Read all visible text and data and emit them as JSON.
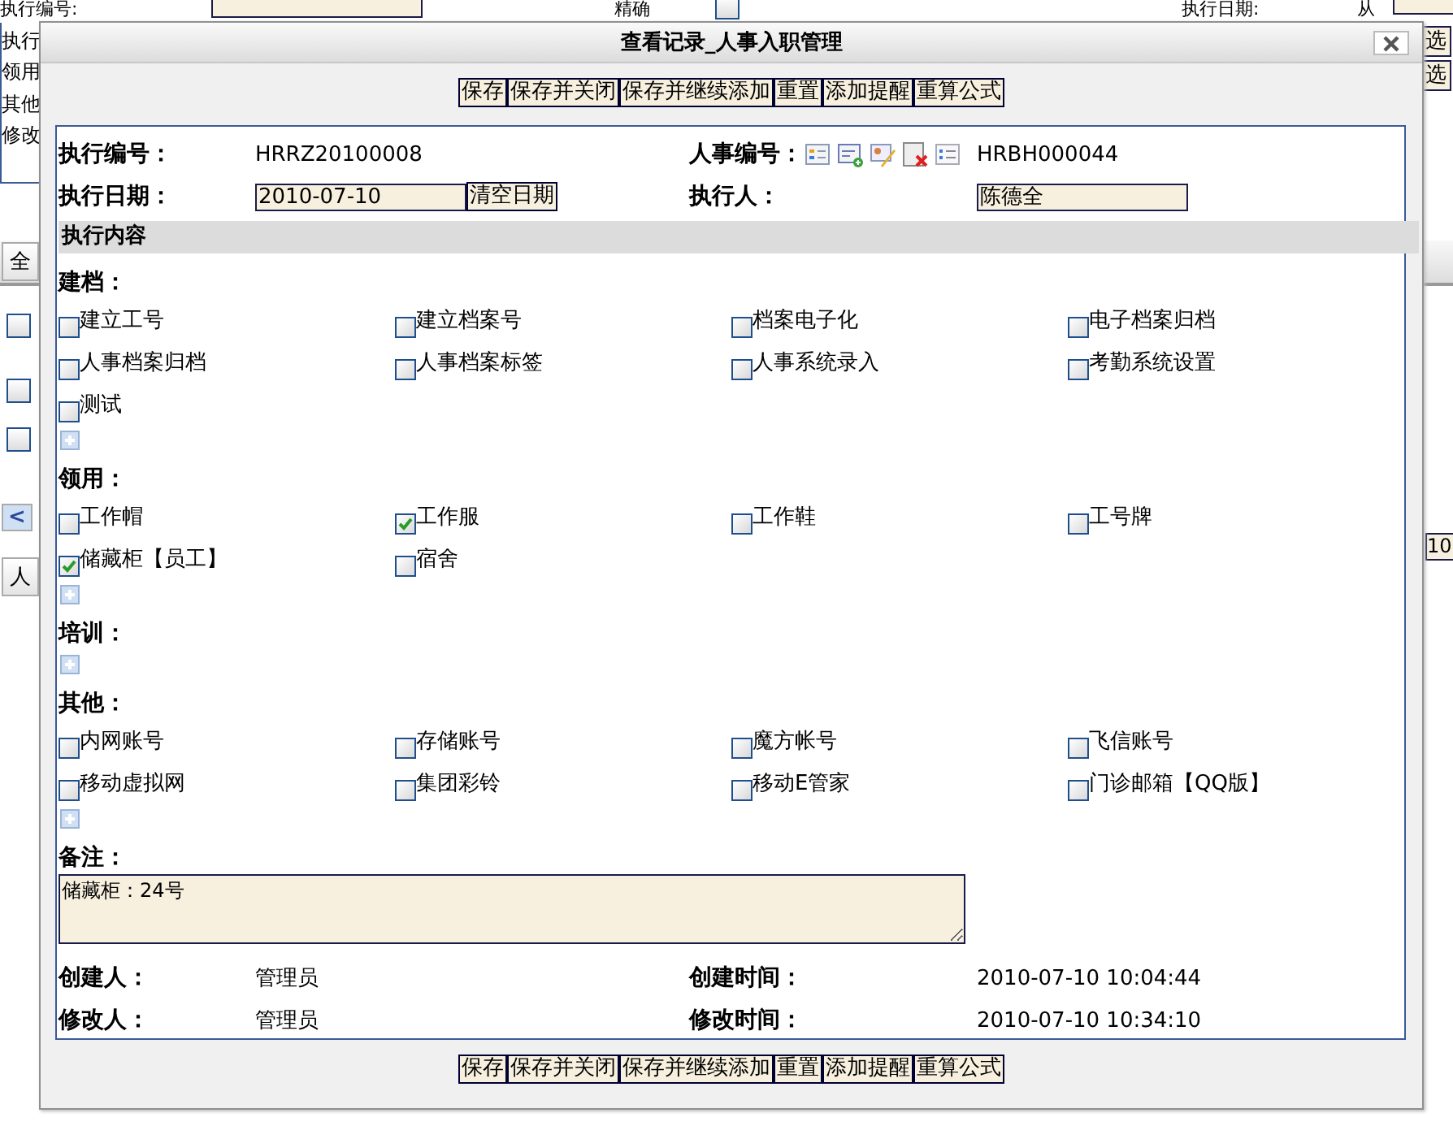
{
  "page_behind": {
    "left_labels": [
      "执行编号:",
      "执行",
      "领用",
      "其他",
      "修改"
    ],
    "match_label": "精确",
    "match_checked": false,
    "date_label": "执行日期:",
    "from_label": "从",
    "choose_buttons": [
      "选",
      "选"
    ],
    "tab": "全",
    "row_checkboxes": [
      {
        "checked": false
      },
      {
        "checked": false
      },
      {
        "checked": false
      }
    ],
    "scroll_left": "<",
    "page_size": "10",
    "bottom_tab": "人"
  },
  "dialog": {
    "title": "查看记录_人事入职管理",
    "toolbar_top": [
      "保存",
      "保存并关闭",
      "保存并继续添加",
      "重置",
      "添加提醒",
      "重算公式"
    ],
    "exec_no": {
      "label": "执行编号：",
      "value": "HRRZ20100008"
    },
    "person_no": {
      "label": "人事编号：",
      "value": "HRBH000044"
    },
    "exec_date": {
      "label": "执行日期：",
      "value": "2010-07-10",
      "clear_button": "清空日期"
    },
    "executor": {
      "label": "执行人：",
      "value": "陈德全"
    },
    "section": "执行内容",
    "groups": [
      {
        "title": "建档：",
        "items": [
          {
            "label": "建立工号",
            "checked": false
          },
          {
            "label": "建立档案号",
            "checked": false
          },
          {
            "label": "档案电子化",
            "checked": false
          },
          {
            "label": "电子档案归档",
            "checked": false
          },
          {
            "label": "人事档案归档",
            "checked": false
          },
          {
            "label": "人事档案标签",
            "checked": false
          },
          {
            "label": "人事系统录入",
            "checked": false
          },
          {
            "label": "考勤系统设置",
            "checked": false
          },
          {
            "label": "测试",
            "checked": false
          }
        ]
      },
      {
        "title": "领用：",
        "items": [
          {
            "label": "工作帽",
            "checked": false
          },
          {
            "label": "工作服",
            "checked": true
          },
          {
            "label": "工作鞋",
            "checked": false
          },
          {
            "label": "工号牌",
            "checked": false
          },
          {
            "label": "储藏柜【员工】",
            "checked": true
          },
          {
            "label": "宿舍",
            "checked": false
          }
        ]
      },
      {
        "title": "培训："
      },
      {
        "title": "其他：",
        "items": [
          {
            "label": "内网账号",
            "checked": false
          },
          {
            "label": "存储账号",
            "checked": false
          },
          {
            "label": "魔方帐号",
            "checked": false
          },
          {
            "label": "飞信账号",
            "checked": false
          },
          {
            "label": "移动虚拟网",
            "checked": false
          },
          {
            "label": "集团彩铃",
            "checked": false
          },
          {
            "label": "移动E管家",
            "checked": false
          },
          {
            "label": "门诊邮箱【QQ版】",
            "checked": false
          }
        ]
      }
    ],
    "note": {
      "label": "备注：",
      "value": "储藏柜：24号"
    },
    "meta": [
      {
        "label": "创建人：",
        "value": "管理员",
        "label2": "创建时间：",
        "value2": "2010-07-10 10:04:44"
      },
      {
        "label": "修改人：",
        "value": "管理员",
        "label2": "修改时间：",
        "value2": "2010-07-10 10:34:10"
      }
    ],
    "toolbar_bottom": [
      "保存",
      "保存并关闭",
      "保存并继续添加",
      "重置",
      "添加提醒",
      "重算公式"
    ]
  }
}
